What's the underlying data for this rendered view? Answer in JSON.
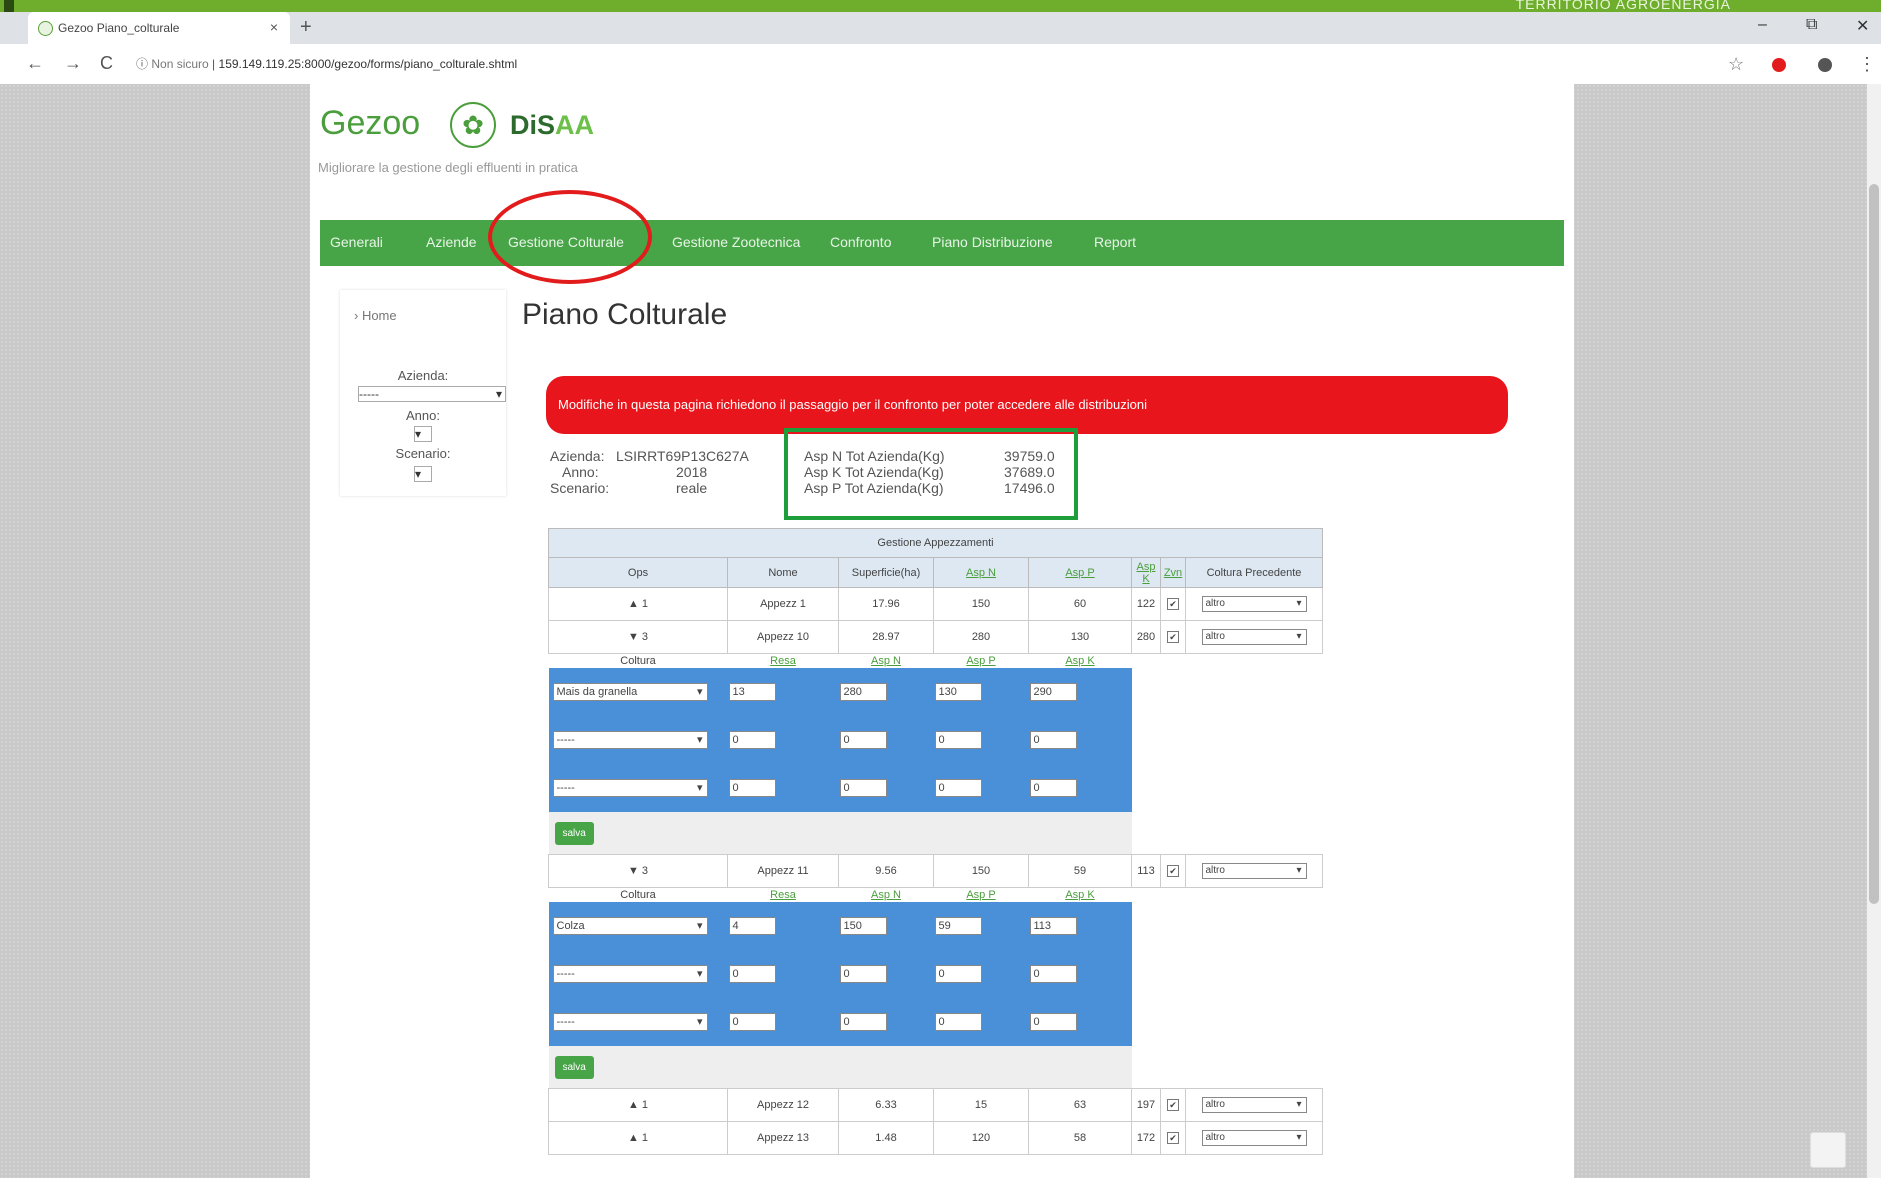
{
  "banner": {
    "text": "TERRITORIO AGROENERGIA"
  },
  "tab": {
    "title": "Gezoo Piano_colturale",
    "close": "×",
    "new": "+"
  },
  "window": {
    "min": "–",
    "max": "⧉",
    "close": "✕"
  },
  "address": {
    "not_secure": "Non sicuro",
    "url": "159.149.119.25:8000/gezoo/forms/piano_colturale.shtml"
  },
  "nav": {
    "back": "←",
    "forward": "→",
    "reload": "C",
    "info": "ⓘ",
    "star": "☆",
    "menu": "⋮"
  },
  "site": {
    "logo": "Gezoo",
    "logo_icon": "✿",
    "logo2_main": "DiS",
    "logo2_accent": "AA",
    "tagline": "Migliorare la gestione degli effluenti in pratica"
  },
  "menu": [
    "Generali",
    "Aziende",
    "Gestione Colturale",
    "Gestione Zootecnica",
    "Confronto",
    "Piano Distribuzione",
    "Report"
  ],
  "sidebar": {
    "crumb": "› Home",
    "azienda_label": "Azienda:",
    "azienda_value": "-----",
    "anno_label": "Anno:",
    "scenario_label": "Scenario:"
  },
  "page": {
    "title": "Piano Colturale"
  },
  "alert": "Modifiche in questa pagina richiedono il passaggio per il confronto per poter accedere alle distribuzioni",
  "info": {
    "azienda_label": "Azienda:",
    "azienda_value": "LSIRRT69P13C627A",
    "anno_label": "Anno:",
    "anno_value": "2018",
    "scenario_label": "Scenario:",
    "scenario_value": "reale",
    "aspN_label": "Asp N Tot Azienda(Kg)",
    "aspN_value": "39759.0",
    "aspK_label": "Asp K Tot Azienda(Kg)",
    "aspK_value": "37689.0",
    "aspP_label": "Asp P Tot Azienda(Kg)",
    "aspP_value": "17496.0"
  },
  "table": {
    "title": "Gestione Appezzamenti",
    "headers": [
      "Ops",
      "Nome",
      "Superficie(ha)",
      "Asp N",
      "Asp P",
      "Asp K",
      "Zvn",
      "Coltura Precedente"
    ],
    "sub_headers": [
      "Coltura",
      "Resa",
      "Asp N",
      "Asp P",
      "Asp K"
    ],
    "save": "salva",
    "rows": [
      {
        "ops": "▲ 1",
        "nome": "Appezz 1",
        "sup": "17.96",
        "n": "150",
        "p": "60",
        "k": "122",
        "prev": "altro"
      },
      {
        "ops": "▼ 3",
        "nome": "Appezz 10",
        "sup": "28.97",
        "n": "280",
        "p": "130",
        "k": "280",
        "prev": "altro",
        "crops": [
          {
            "coltura": "Mais da granella",
            "resa": "13",
            "n": "280",
            "p": "130",
            "k": "290"
          },
          {
            "coltura": "-----",
            "resa": "0",
            "n": "0",
            "p": "0",
            "k": "0"
          },
          {
            "coltura": "-----",
            "resa": "0",
            "n": "0",
            "p": "0",
            "k": "0"
          }
        ]
      },
      {
        "ops": "▼ 3",
        "nome": "Appezz 11",
        "sup": "9.56",
        "n": "150",
        "p": "59",
        "k": "113",
        "prev": "altro",
        "crops": [
          {
            "coltura": "Colza",
            "resa": "4",
            "n": "150",
            "p": "59",
            "k": "113"
          },
          {
            "coltura": "-----",
            "resa": "0",
            "n": "0",
            "p": "0",
            "k": "0"
          },
          {
            "coltura": "-----",
            "resa": "0",
            "n": "0",
            "p": "0",
            "k": "0"
          }
        ]
      },
      {
        "ops": "▲ 1",
        "nome": "Appezz 12",
        "sup": "6.33",
        "n": "15",
        "p": "63",
        "k": "197",
        "prev": "altro"
      },
      {
        "ops": "▲ 1",
        "nome": "Appezz 13",
        "sup": "1.48",
        "n": "120",
        "p": "58",
        "k": "172",
        "prev": "altro"
      }
    ]
  }
}
